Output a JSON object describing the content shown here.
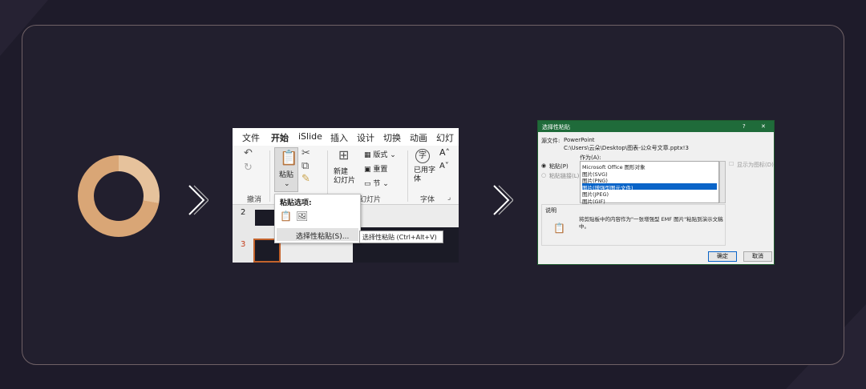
{
  "ribbon_screenshot": {
    "tabs": [
      "文件",
      "开始",
      "iSlide",
      "插入",
      "设计",
      "切换",
      "动画",
      "幻灯片"
    ],
    "active_tab": "开始",
    "paste_label": "粘贴",
    "group_undo": "撤消",
    "new_slide_label": "新建\n幻灯片",
    "layout_label": "版式",
    "reset_label": "重置",
    "section_label": "节",
    "group_slides": "幻灯片",
    "font_group_label": "字体",
    "use_font_label": "已用字\n体",
    "font_char": "字",
    "paste_options_title": "粘贴选项:",
    "paste_special_item": "选择性粘贴(S)...",
    "tooltip": "选择性粘贴 (Ctrl+Alt+V)",
    "slide_numbers": [
      "2",
      "3"
    ]
  },
  "dialog_screenshot": {
    "title": "选择性粘贴",
    "help_button": "?",
    "close_button": "✕",
    "source_label": "源文件:",
    "source_app": "PowerPoint",
    "source_path": "C:\\Users\\云朵\\Desktop\\图表-公众号文章.pptx!3",
    "as_label": "作为(A):",
    "option_paste": "粘贴(P)",
    "option_paste_link": "粘贴链接(L)",
    "formats": [
      "Microsoft Office 图形对象",
      "图片(SVG)",
      "图片(PNG)",
      "图片(增强型图元文件)",
      "图片(JPEG)",
      "图片(GIF)"
    ],
    "selected_format_index": 3,
    "show_as_icon": "显示为图标(D)",
    "result_label": "说明",
    "result_text": "将剪贴板中的内容作为\"一张增强型 EMF 图片\"粘贴到演示文稿\n中。",
    "ok_button": "确定",
    "cancel_button": "取消"
  },
  "colors": {
    "donut_light": "#e6c29c",
    "donut_dark": "#d9a676",
    "chevron": "#ffffff",
    "card_border": "#6f6166"
  }
}
